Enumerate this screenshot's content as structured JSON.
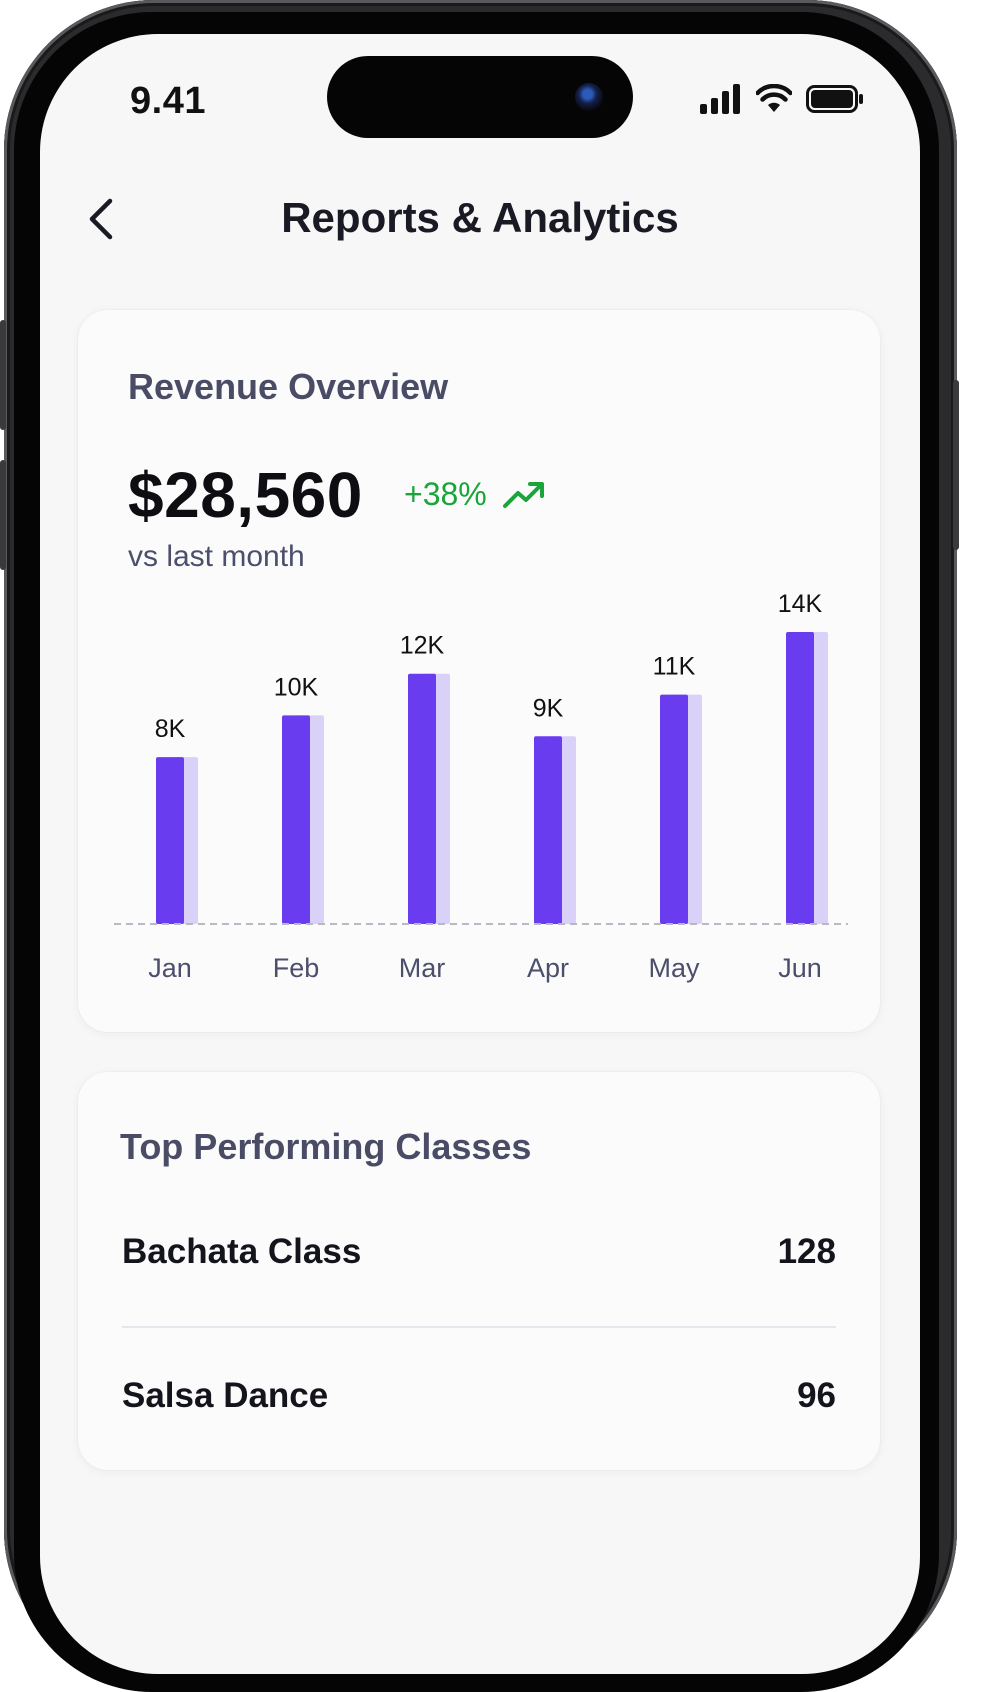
{
  "status_bar": {
    "time": "9.41",
    "icons": [
      "signal-icon",
      "wifi-icon",
      "battery-icon"
    ]
  },
  "nav": {
    "back_icon": "chevron-left-icon",
    "title": "Reports & Analytics"
  },
  "revenue": {
    "heading": "Revenue Overview",
    "amount": "$28,560",
    "change": "+38%",
    "trend_icon": "trending-up-icon",
    "subtext": "vs last month"
  },
  "chart_data": {
    "type": "bar",
    "categories": [
      "Jan",
      "Feb",
      "Mar",
      "Apr",
      "May",
      "Jun"
    ],
    "values": [
      8000,
      10000,
      12000,
      9000,
      11000,
      14000
    ],
    "data_labels": [
      "8K",
      "10K",
      "12K",
      "9K",
      "11K",
      "14K"
    ],
    "title": "",
    "xlabel": "",
    "ylabel": "",
    "ylim": [
      0,
      14000
    ],
    "grid": false,
    "baseline": "dashed",
    "colors": {
      "bar": "#6a3cf0",
      "bar_shadow": "#d9d1f7",
      "label": "#111111",
      "axis_label": "#4c4f6b"
    }
  },
  "top_classes": {
    "heading": "Top Performing Classes",
    "items": [
      {
        "name": "Bachata Class",
        "value": "128"
      },
      {
        "name": "Salsa Dance",
        "value": "96"
      }
    ]
  },
  "colors": {
    "accent": "#6a3cf0",
    "positive": "#1aa53a",
    "heading_text": "#4a4c66",
    "background": "#f7f7f8",
    "card": "#fbfbfc"
  }
}
